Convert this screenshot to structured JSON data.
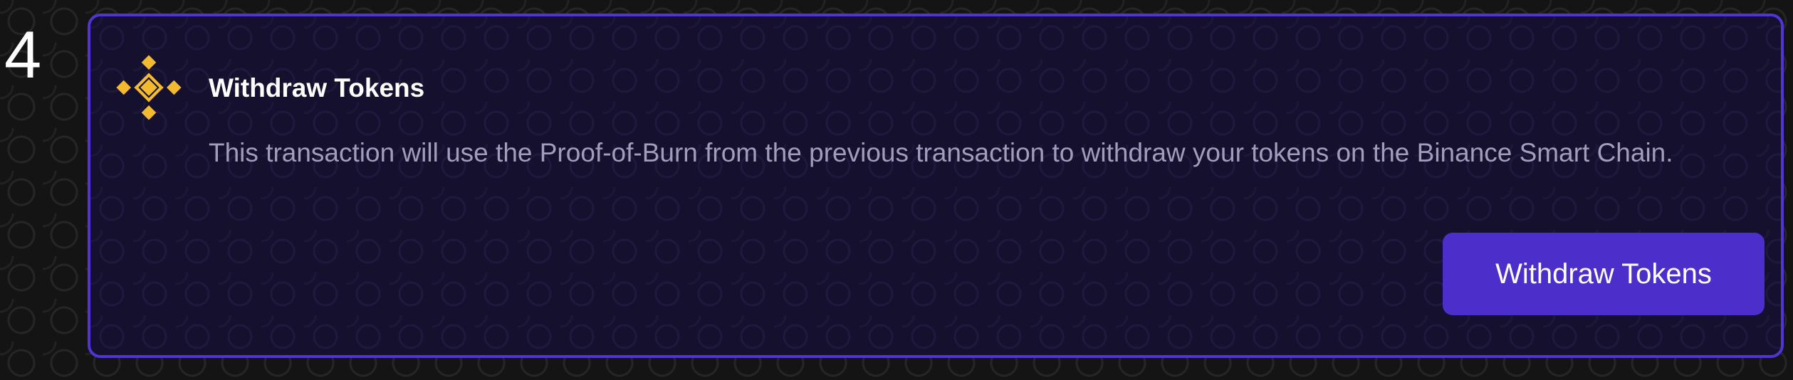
{
  "step": {
    "number": "4"
  },
  "card": {
    "title": "Withdraw Tokens",
    "description": "This transaction will use the Proof-of-Burn from the previous transaction to withdraw your tokens on the Binance Smart Chain.",
    "button_label": "Withdraw Tokens",
    "logo_icon": "binance-logo-icon"
  },
  "colors": {
    "page_background": "#141414",
    "card_background": "#14102e",
    "card_border": "#5234d3",
    "button_background": "#4c2ecb",
    "binance_gold": "#f3ba2f",
    "description_text": "#a19dba"
  }
}
